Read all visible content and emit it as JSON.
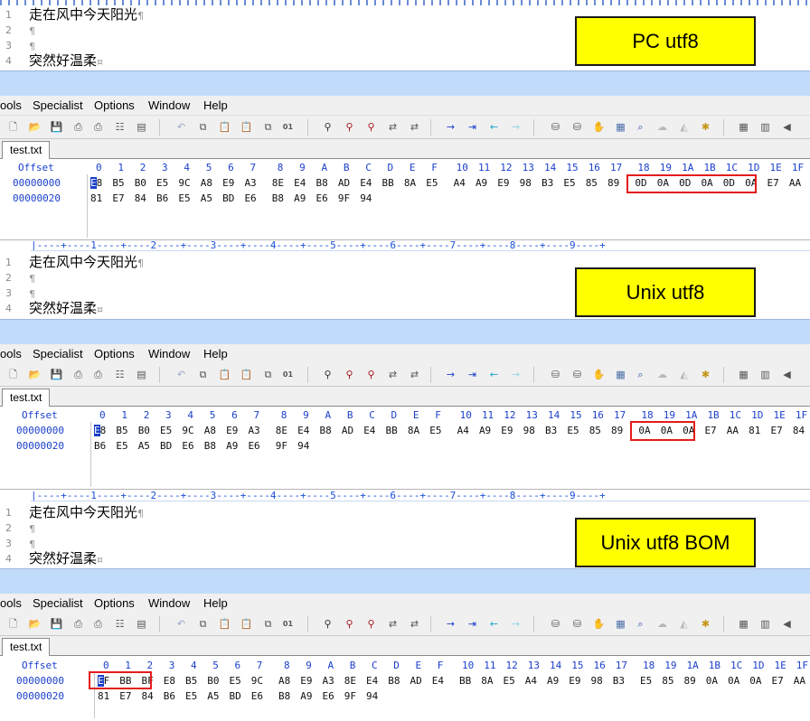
{
  "panels": [
    {
      "label": "PC utf8",
      "editor": {
        "lines": [
          {
            "num": "1",
            "text": "走在风中今天阳光",
            "mark": "¶"
          },
          {
            "num": "2",
            "text": "",
            "mark": "¶"
          },
          {
            "num": "3",
            "text": "",
            "mark": "¶"
          },
          {
            "num": "4",
            "text": "突然好温柔",
            "mark": "¤"
          }
        ]
      },
      "menu": [
        "ools",
        "Specialist",
        "Options",
        "Window",
        "Help"
      ],
      "tab": "test.txt",
      "hex": {
        "offset_label": "Offset",
        "columns": [
          "0",
          "1",
          "2",
          "3",
          "4",
          "5",
          "6",
          "7",
          "8",
          "9",
          "A",
          "B",
          "C",
          "D",
          "E",
          "F",
          "10",
          "11",
          "12",
          "13",
          "14",
          "15",
          "16",
          "17",
          "18",
          "19",
          "1A",
          "1B",
          "1C",
          "1D",
          "1E",
          "1F"
        ],
        "rows": [
          {
            "offset": "00000000",
            "bytes": [
              "E8",
              "B5",
              "B0",
              "E5",
              "9C",
              "A8",
              "E9",
              "A3",
              "8E",
              "E4",
              "B8",
              "AD",
              "E4",
              "BB",
              "8A",
              "E5",
              "A4",
              "A9",
              "E9",
              "98",
              "B3",
              "E5",
              "85",
              "89",
              "0D",
              "0A",
              "0D",
              "0A",
              "0D",
              "0A",
              "E7",
              "AA"
            ]
          },
          {
            "offset": "00000020",
            "bytes": [
              "81",
              "E7",
              "84",
              "B6",
              "E5",
              "A5",
              "BD",
              "E6",
              "B8",
              "A9",
              "E6",
              "9F",
              "94"
            ]
          }
        ]
      }
    },
    {
      "label": "Unix utf8",
      "editor": {
        "ruler": "|----+----1----+----2----+----3----+----4----+----5----+----6----+----7----+----8----+----9----+",
        "lines": [
          {
            "num": "1",
            "text": "走在风中今天阳光",
            "mark": "¶"
          },
          {
            "num": "2",
            "text": "",
            "mark": "¶"
          },
          {
            "num": "3",
            "text": "",
            "mark": "¶"
          },
          {
            "num": "4",
            "text": "突然好温柔",
            "mark": "¤"
          }
        ]
      },
      "menu": [
        "ools",
        "Specialist",
        "Options",
        "Window",
        "Help"
      ],
      "tab": "test.txt",
      "hex": {
        "offset_label": "Offset",
        "columns": [
          "0",
          "1",
          "2",
          "3",
          "4",
          "5",
          "6",
          "7",
          "8",
          "9",
          "A",
          "B",
          "C",
          "D",
          "E",
          "F",
          "10",
          "11",
          "12",
          "13",
          "14",
          "15",
          "16",
          "17",
          "18",
          "19",
          "1A",
          "1B",
          "1C",
          "1D",
          "1E",
          "1F"
        ],
        "rows": [
          {
            "offset": "00000000",
            "bytes": [
              "E8",
              "B5",
              "B0",
              "E5",
              "9C",
              "A8",
              "E9",
              "A3",
              "8E",
              "E4",
              "B8",
              "AD",
              "E4",
              "BB",
              "8A",
              "E5",
              "A4",
              "A9",
              "E9",
              "98",
              "B3",
              "E5",
              "85",
              "89",
              "0A",
              "0A",
              "0A",
              "E7",
              "AA",
              "81",
              "E7",
              "84"
            ]
          },
          {
            "offset": "00000020",
            "bytes": [
              "B6",
              "E5",
              "A5",
              "BD",
              "E6",
              "B8",
              "A9",
              "E6",
              "9F",
              "94"
            ]
          }
        ]
      }
    },
    {
      "label": "Unix utf8  BOM",
      "editor": {
        "ruler": "|----+----1----+----2----+----3----+----4----+----5----+----6----+----7----+----8----+----9----+",
        "lines": [
          {
            "num": "1",
            "text": "走在风中今天阳光",
            "mark": "¶"
          },
          {
            "num": "2",
            "text": "",
            "mark": "¶"
          },
          {
            "num": "3",
            "text": "",
            "mark": "¶"
          },
          {
            "num": "4",
            "text": "突然好温柔",
            "mark": "¤"
          }
        ]
      },
      "menu": [
        "ools",
        "Specialist",
        "Options",
        "Window",
        "Help"
      ],
      "tab": "test.txt",
      "hex": {
        "offset_label": "Offset",
        "columns": [
          "0",
          "1",
          "2",
          "3",
          "4",
          "5",
          "6",
          "7",
          "8",
          "9",
          "A",
          "B",
          "C",
          "D",
          "E",
          "F",
          "10",
          "11",
          "12",
          "13",
          "14",
          "15",
          "16",
          "17",
          "18",
          "19",
          "1A",
          "1B",
          "1C",
          "1D",
          "1E",
          "1F"
        ],
        "rows": [
          {
            "offset": "00000000",
            "bytes": [
              "EF",
              "BB",
              "BF",
              "E8",
              "B5",
              "B0",
              "E5",
              "9C",
              "A8",
              "E9",
              "A3",
              "8E",
              "E4",
              "B8",
              "AD",
              "E4",
              "BB",
              "8A",
              "E5",
              "A4",
              "A9",
              "E9",
              "98",
              "B3",
              "E5",
              "85",
              "89",
              "0A",
              "0A",
              "0A",
              "E7",
              "AA"
            ]
          },
          {
            "offset": "00000020",
            "bytes": [
              "81",
              "E7",
              "84",
              "B6",
              "E5",
              "A5",
              "BD",
              "E6",
              "B8",
              "A9",
              "E6",
              "9F",
              "94"
            ]
          }
        ]
      }
    }
  ],
  "icons": [
    "new-file-icon",
    "open-folder-icon",
    "save-icon",
    "print-preview-icon",
    "print-icon",
    "properties-icon",
    "toolbox-icon",
    "undo-icon",
    "copy-icon",
    "paste-icon",
    "clipboard-icon",
    "paste-special-icon",
    "binary-icon",
    "find-icon",
    "find-next-icon",
    "find-hex-icon",
    "replace-icon",
    "replace-hex-icon",
    "goto-icon",
    "insert-icon",
    "back-arrow-icon",
    "forward-arrow-icon",
    "disk-icon",
    "disks-icon",
    "hand-tool-icon",
    "calculator-icon",
    "zoom-icon",
    "cloud-icon",
    "chart-icon",
    "gear-icon",
    "grid-icon",
    "columns-icon",
    "scroll-left-icon"
  ],
  "colors": {
    "label_bg": "#ffff00",
    "highlight_border": "#e31c1c",
    "offset_blue": "#1a3fcb",
    "titlebar": "#c0dcfa"
  }
}
